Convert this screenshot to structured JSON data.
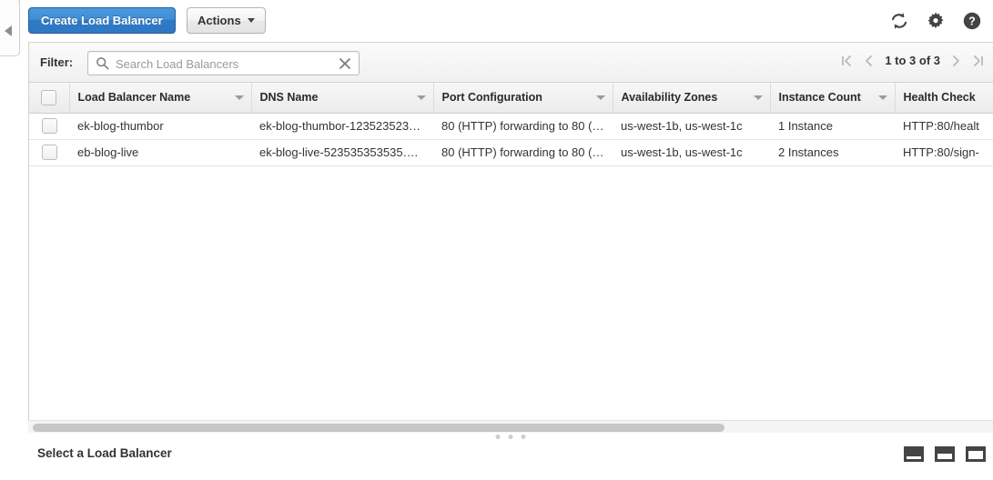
{
  "toolbar": {
    "create_label": "Create Load Balancer",
    "actions_label": "Actions",
    "refresh_icon": "refresh-icon",
    "settings_icon": "gear-icon",
    "help_icon": "help-icon"
  },
  "left_rail": {
    "collapse_icon": "collapse-left-icon"
  },
  "filter": {
    "label": "Filter:",
    "value": "",
    "placeholder": "Search Load Balancers",
    "search_icon": "search-icon",
    "clear_icon": "clear-icon"
  },
  "pagination": {
    "first_icon": "first-page-icon",
    "prev_icon": "previous-page-icon",
    "range_text": "1 to 3 of 3",
    "next_icon": "next-page-icon",
    "last_icon": "last-page-icon"
  },
  "table": {
    "columns": [
      {
        "label": "Load Balancer Name"
      },
      {
        "label": "DNS Name"
      },
      {
        "label": "Port Configuration"
      },
      {
        "label": "Availability Zones"
      },
      {
        "label": "Instance Count"
      },
      {
        "label": "Health Check"
      }
    ],
    "rows": [
      {
        "name": "ek-blog-thumbor",
        "dns": "ek-blog-thumbor-123523523…",
        "ports": "80 (HTTP) forwarding to 80 (…",
        "zones": "us-west-1b, us-west-1c",
        "instances": "1 Instance",
        "health": "HTTP:80/healt"
      },
      {
        "name": "eb-blog-live",
        "dns": "ek-blog-live-523535353535….",
        "ports": "80 (HTTP) forwarding to 80 (…",
        "zones": "us-west-1b, us-west-1c",
        "instances": "2 Instances",
        "health": "HTTP:80/sign-"
      }
    ]
  },
  "detail": {
    "title": "Select a Load Balancer",
    "layout_small_icon": "panel-layout-small-icon",
    "layout_medium_icon": "panel-layout-medium-icon",
    "layout_large_icon": "panel-layout-large-icon"
  },
  "colors": {
    "primary_button": "#2f79c4",
    "panel_border": "#d2d2d2",
    "header_text": "#2a2a2a"
  }
}
